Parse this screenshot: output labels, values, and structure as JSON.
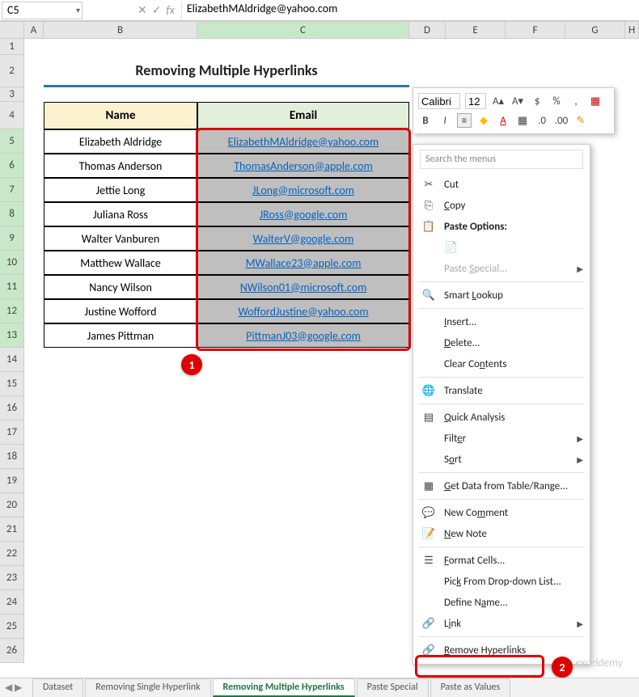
{
  "nameBox": "C5",
  "formula": "ElizabethMAldridge@yahoo.com",
  "columns": [
    "A",
    "B",
    "C",
    "D",
    "E",
    "F",
    "G",
    "H"
  ],
  "rows": [
    "1",
    "2",
    "3",
    "4",
    "5",
    "6",
    "7",
    "8",
    "9",
    "10",
    "11",
    "12",
    "13",
    "14",
    "15",
    "16",
    "17",
    "18",
    "19",
    "20",
    "21",
    "22",
    "23",
    "24",
    "25",
    "26"
  ],
  "title": "Removing Multiple Hyperlinks",
  "headers": {
    "name": "Name",
    "email": "Email"
  },
  "tableRows": [
    {
      "name": "Elizabeth Aldridge",
      "email": "ElizabethMAldridge@yahoo.com"
    },
    {
      "name": "Thomas Anderson",
      "email": "ThomasAnderson@apple.com"
    },
    {
      "name": "Jettie Long",
      "email": "JLong@microsoft.com"
    },
    {
      "name": "Juliana Ross",
      "email": "JRoss@google.com"
    },
    {
      "name": "Walter Vanburen",
      "email": "WalterV@google.com"
    },
    {
      "name": "Matthew Wallace",
      "email": "MWallace23@apple.com"
    },
    {
      "name": "Nancy Wilson",
      "email": "NWilson01@microsoft.com"
    },
    {
      "name": "Justine Wofford",
      "email": "WoffordJustine@yahoo.com"
    },
    {
      "name": "James Pittman",
      "email": "PittmanJ03@google.com"
    }
  ],
  "miniToolbar": {
    "font": "Calibri",
    "size": "12"
  },
  "ctx": {
    "search": "Search the menus",
    "cut": "Cut",
    "copy": "Copy",
    "pasteOptions": "Paste Options:",
    "pasteSpecial": "Paste Special...",
    "smartLookup": "Smart Lookup",
    "insert": "Insert...",
    "delete": "Delete...",
    "clear": "Clear Contents",
    "translate": "Translate",
    "quickAnalysis": "Quick Analysis",
    "filter": "Filter",
    "sort": "Sort",
    "getData": "Get Data from Table/Range...",
    "newComment": "New Comment",
    "newNote": "New Note",
    "formatCells": "Format Cells...",
    "pickList": "Pick From Drop-down List...",
    "defineName": "Define Name...",
    "link": "Link",
    "removeHyperlinks": "Remove Hyperlinks"
  },
  "tabs": [
    "Dataset",
    "Removing Single Hyperlink",
    "Removing Multiple Hyperlinks",
    "Paste Special",
    "Paste as Values"
  ],
  "activeTab": 2,
  "callouts": {
    "one": "1",
    "two": "2"
  },
  "watermark": "exceldemy"
}
